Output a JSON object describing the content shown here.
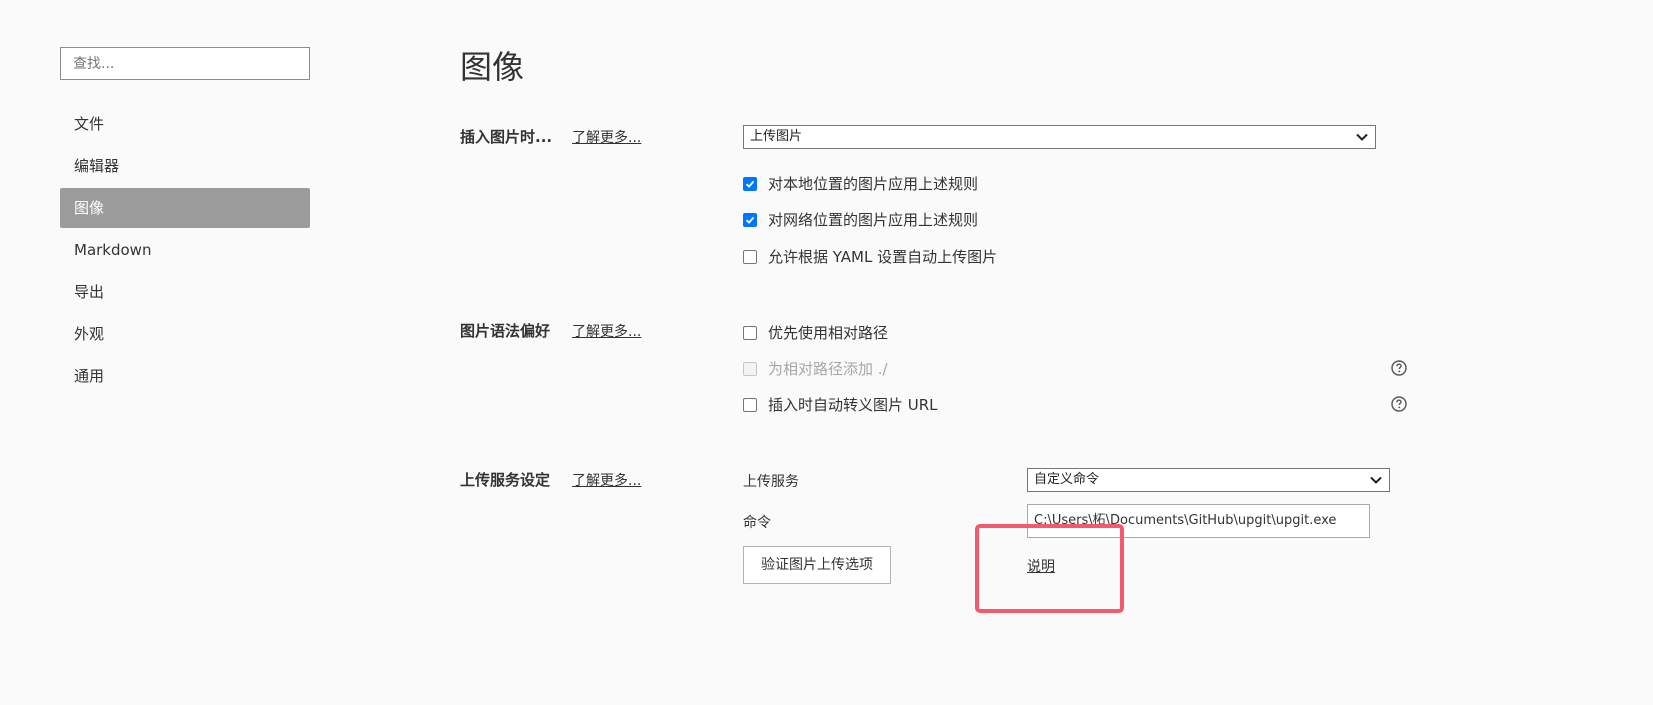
{
  "search": {
    "placeholder": "查找..."
  },
  "sidebar": {
    "items": [
      {
        "label": "文件"
      },
      {
        "label": "编辑器"
      },
      {
        "label": "图像"
      },
      {
        "label": "Markdown"
      },
      {
        "label": "导出"
      },
      {
        "label": "外观"
      },
      {
        "label": "通用"
      }
    ],
    "active_index": 2
  },
  "page": {
    "title": "图像"
  },
  "insert_section": {
    "label": "插入图片时...",
    "learn_more": "了解更多...",
    "select_value": "上传图片",
    "options": [
      {
        "label": "对本地位置的图片应用上述规则",
        "checked": true,
        "disabled": false
      },
      {
        "label": "对网络位置的图片应用上述规则",
        "checked": true,
        "disabled": false
      },
      {
        "label": "允许根据 YAML 设置自动上传图片",
        "checked": false,
        "disabled": false
      }
    ]
  },
  "syntax_section": {
    "label": "图片语法偏好",
    "learn_more": "了解更多...",
    "options": [
      {
        "label": "优先使用相对路径",
        "checked": false,
        "disabled": false
      },
      {
        "label": "为相对路径添加 ./",
        "checked": false,
        "disabled": true
      },
      {
        "label": "插入时自动转义图片 URL",
        "checked": false,
        "disabled": false
      }
    ]
  },
  "upload_section": {
    "label": "上传服务设定",
    "learn_more": "了解更多...",
    "service_label": "上传服务",
    "service_value": "自定义命令",
    "command_label": "命令",
    "command_value": "C:\\Users\\柘\\Documents\\GitHub\\upgit\\upgit.exe",
    "verify_button": "验证图片上传选项",
    "doc_link": "说明"
  },
  "colors": {
    "accent": "#0075ff",
    "active_nav": "#9b9b9b",
    "highlight": "#f25b6e"
  }
}
